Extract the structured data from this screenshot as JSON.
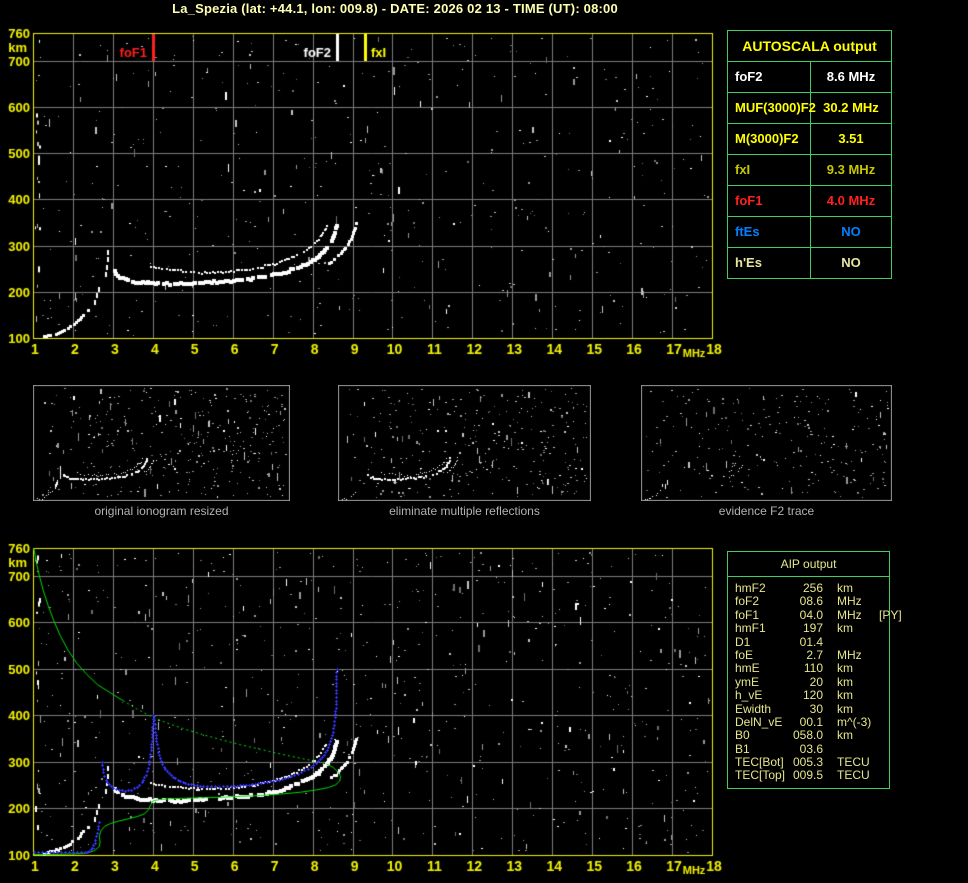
{
  "window": {
    "title": "La_Spezia (lat: +44.1, lon: 009.8) - DATE: 2026 02 13 - TIME (UT): 08:00"
  },
  "autoscala_table": {
    "header": "AUTOSCALA output",
    "rows": [
      {
        "label": "foF2",
        "value": "8.6 MHz",
        "color": "#ffffff"
      },
      {
        "label": "MUF(3000)F2",
        "value": "30.2 MHz",
        "color": "#ffff00"
      },
      {
        "label": "M(3000)F2",
        "value": "3.51",
        "color": "#ffff00"
      },
      {
        "label": "fxI",
        "value": "9.3 MHz",
        "color": "#c8c800"
      },
      {
        "label": "foF1",
        "value": "4.0 MHz",
        "color": "#ff2020"
      },
      {
        "label": "ftEs",
        "value": "NO",
        "color": "#0080ff"
      },
      {
        "label": "h'Es",
        "value": "NO",
        "color": "#e8e8a0"
      }
    ]
  },
  "aip_table": {
    "header": "AIP output",
    "rows": [
      {
        "name": "hmF2",
        "value": "256",
        "unit": "km",
        "extra": ""
      },
      {
        "name": "foF2",
        "value": "08.6",
        "unit": "MHz",
        "extra": ""
      },
      {
        "name": "foF1",
        "value": "04.0",
        "unit": "MHz",
        "extra": "[PY]"
      },
      {
        "name": "hmF1",
        "value": "197",
        "unit": "km",
        "extra": ""
      },
      {
        "name": "D1",
        "value": "01.4",
        "unit": "",
        "extra": ""
      },
      {
        "name": "foE",
        "value": "2.7",
        "unit": "MHz",
        "extra": ""
      },
      {
        "name": "hmE",
        "value": "110",
        "unit": "km",
        "extra": ""
      },
      {
        "name": "ymE",
        "value": "20",
        "unit": "km",
        "extra": ""
      },
      {
        "name": "h_vE",
        "value": "120",
        "unit": "km",
        "extra": ""
      },
      {
        "name": "Ewidth",
        "value": "30",
        "unit": "km",
        "extra": ""
      },
      {
        "name": "DelN_vE",
        "value": "00.1",
        "unit": "m^(-3)",
        "extra": ""
      },
      {
        "name": "B0",
        "value": "058.0",
        "unit": "km",
        "extra": ""
      },
      {
        "name": "B1",
        "value": "03.6",
        "unit": "",
        "extra": ""
      },
      {
        "name": "TEC[Bot]",
        "value": "005.3",
        "unit": "TECU",
        "extra": ""
      },
      {
        "name": "TEC[Top]",
        "value": "009.5",
        "unit": "TECU",
        "extra": ""
      }
    ]
  },
  "panels": [
    {
      "caption": "original ionogram resized"
    },
    {
      "caption": "eliminate multiple reflections"
    },
    {
      "caption": "evidence F2 trace"
    }
  ],
  "chart_data": {
    "type": "scatter",
    "title": "Ionogram La_Spezia 2026-02-13 08:00 UT",
    "axes": {
      "xlabel": "MHz",
      "ylabel": "km",
      "xlim": [
        1,
        18
      ],
      "ylim": [
        100,
        760
      ],
      "x_ticks": [
        1,
        2,
        3,
        4,
        5,
        6,
        7,
        8,
        9,
        10,
        11,
        12,
        13,
        14,
        15,
        16,
        17,
        18
      ],
      "y_ticks": [
        760,
        700,
        600,
        500,
        400,
        300,
        200,
        100
      ],
      "grid": true
    },
    "colors": {
      "axis": "#f2f200",
      "tick_label": "#f2f200",
      "grid": "#7c7c7c",
      "echo_white": "#ffffff",
      "profile_green": "#00dc00",
      "synthesized_blue": "#3434ff",
      "table_border": "#3ecf60"
    },
    "markers": [
      {
        "label": "foF1",
        "freq_mhz": 4.0,
        "color": "#ff2020",
        "side": "left"
      },
      {
        "label": "foF2",
        "freq_mhz": 8.6,
        "color": "#ffffff",
        "side": "left"
      },
      {
        "label": "fxI",
        "freq_mhz": 9.3,
        "color": "#ffff00",
        "side": "right"
      }
    ],
    "traces": {
      "w_e": {
        "desc": "E-region echo tail",
        "color": "#ffffff",
        "width": 3,
        "style": "chunk",
        "points": [
          [
            1.3,
            102
          ],
          [
            1.45,
            105
          ],
          [
            1.6,
            109
          ],
          [
            1.75,
            114
          ],
          [
            1.9,
            121
          ],
          [
            2.05,
            130
          ],
          [
            2.18,
            141
          ],
          [
            2.3,
            153
          ],
          [
            2.42,
            166
          ]
        ]
      },
      "w_e2": {
        "desc": "sparse echoes above E",
        "color": "#ffffff",
        "width": 2,
        "style": "blocks",
        "points": [
          [
            2.55,
            178
          ],
          [
            2.6,
            192
          ],
          [
            2.65,
            206
          ],
          [
            2.83,
            238
          ],
          [
            2.85,
            254
          ],
          [
            2.87,
            270
          ],
          [
            2.89,
            286
          ]
        ]
      },
      "w_f": {
        "desc": "F-region main echo trace",
        "color": "#ffffff",
        "width": 4,
        "style": "chunk",
        "points": [
          [
            3.05,
            243
          ],
          [
            3.12,
            234
          ],
          [
            3.25,
            228
          ],
          [
            3.45,
            223
          ],
          [
            3.7,
            220
          ],
          [
            4.0,
            218
          ],
          [
            4.35,
            217
          ],
          [
            4.7,
            217
          ],
          [
            5.05,
            218
          ],
          [
            5.4,
            220
          ],
          [
            5.75,
            222
          ],
          [
            6.1,
            224
          ],
          [
            6.45,
            228
          ],
          [
            6.8,
            232
          ],
          [
            7.1,
            237
          ],
          [
            7.4,
            245
          ],
          [
            7.7,
            254
          ],
          [
            7.95,
            265
          ],
          [
            8.15,
            277
          ],
          [
            8.32,
            291
          ],
          [
            8.45,
            307
          ],
          [
            8.55,
            326
          ],
          [
            8.62,
            347
          ]
        ]
      },
      "w_fu": {
        "desc": "F-region upper echo branch",
        "color": "#ffffff",
        "width": 2,
        "style": "chunk",
        "points": [
          [
            3.95,
            253
          ],
          [
            4.3,
            249
          ],
          [
            4.7,
            245
          ],
          [
            5.1,
            242
          ],
          [
            5.5,
            241
          ],
          [
            5.9,
            243
          ],
          [
            6.3,
            247
          ],
          [
            6.7,
            253
          ],
          [
            7.0,
            259
          ],
          [
            7.3,
            267
          ],
          [
            7.6,
            278
          ],
          [
            7.85,
            291
          ],
          [
            8.05,
            305
          ],
          [
            8.2,
            319
          ],
          [
            8.3,
            333
          ],
          [
            8.38,
            347
          ]
        ]
      },
      "w_x": {
        "desc": "x-mode rising tip near fxI",
        "color": "#ffffff",
        "width": 3,
        "style": "chunk",
        "points": [
          [
            8.42,
            262
          ],
          [
            8.6,
            273
          ],
          [
            8.76,
            287
          ],
          [
            8.9,
            303
          ],
          [
            9.0,
            320
          ],
          [
            9.07,
            339
          ],
          [
            9.1,
            354
          ]
        ]
      },
      "g_top": {
        "desc": "AIP profile topside (solid)",
        "color": "#00dc00",
        "width": 1,
        "style": "line",
        "points": [
          [
            1.02,
            760
          ],
          [
            1.08,
            730
          ],
          [
            1.16,
            700
          ],
          [
            1.26,
            668
          ],
          [
            1.38,
            636
          ],
          [
            1.52,
            604
          ],
          [
            1.68,
            572
          ],
          [
            1.88,
            540
          ],
          [
            2.1,
            512
          ],
          [
            2.35,
            488
          ],
          [
            2.62,
            466
          ],
          [
            2.95,
            448
          ],
          [
            3.25,
            432
          ]
        ]
      },
      "g_mid": {
        "desc": "AIP profile (dotted)",
        "color": "#00dc00",
        "width": 1,
        "style": "dash",
        "points": [
          [
            3.25,
            432
          ],
          [
            3.6,
            414
          ],
          [
            3.95,
            398
          ],
          [
            4.35,
            384
          ],
          [
            4.75,
            372
          ],
          [
            5.2,
            360
          ],
          [
            5.7,
            348
          ],
          [
            6.2,
            337
          ],
          [
            6.7,
            327
          ],
          [
            7.2,
            317
          ],
          [
            7.7,
            308
          ],
          [
            8.1,
            301
          ],
          [
            8.35,
            296
          ]
        ]
      },
      "g_bot": {
        "desc": "AIP profile F-peak wrap and bottomside",
        "color": "#00dc00",
        "width": 1,
        "style": "line",
        "points": [
          [
            8.35,
            296
          ],
          [
            8.52,
            288
          ],
          [
            8.63,
            279
          ],
          [
            8.7,
            269
          ],
          [
            8.68,
            259
          ],
          [
            8.58,
            251
          ],
          [
            8.4,
            245
          ],
          [
            8.1,
            240
          ],
          [
            7.7,
            235
          ],
          [
            7.2,
            231
          ],
          [
            6.7,
            228
          ],
          [
            6.2,
            226
          ],
          [
            5.7,
            224
          ],
          [
            5.2,
            223
          ],
          [
            4.8,
            222
          ],
          [
            4.45,
            221
          ],
          [
            4.15,
            219
          ],
          [
            4.0,
            216
          ],
          [
            3.95,
            208
          ],
          [
            3.88,
            196
          ],
          [
            3.78,
            188
          ],
          [
            3.62,
            183
          ],
          [
            3.4,
            178
          ],
          [
            3.15,
            173
          ],
          [
            2.95,
            168
          ],
          [
            2.8,
            162
          ],
          [
            2.7,
            152
          ],
          [
            2.66,
            140
          ],
          [
            2.68,
            128
          ],
          [
            2.66,
            118
          ],
          [
            2.55,
            110
          ],
          [
            2.4,
            105
          ],
          [
            2.2,
            103
          ],
          [
            1.9,
            102
          ],
          [
            1.5,
            101
          ],
          [
            1.02,
            101
          ]
        ]
      },
      "b_row": {
        "desc": "synthesized trace E (blue crosses)",
        "color": "#3434ff",
        "width": 1,
        "style": "plus",
        "points": [
          [
            1.02,
            106
          ],
          [
            2.3,
            106
          ],
          [
            2.4,
            109
          ],
          [
            2.48,
            116
          ],
          [
            2.54,
            126
          ],
          [
            2.58,
            140
          ],
          [
            2.62,
            156
          ],
          [
            2.64,
            170
          ]
        ]
      },
      "b_f1": {
        "desc": "synthesized F1 cusp at foF1",
        "color": "#3434ff",
        "width": 1,
        "style": "plus",
        "points": [
          [
            2.72,
            300
          ],
          [
            2.76,
            278
          ],
          [
            2.82,
            262
          ],
          [
            2.9,
            252
          ],
          [
            3.0,
            245
          ],
          [
            3.15,
            240
          ],
          [
            3.3,
            238
          ],
          [
            3.45,
            240
          ],
          [
            3.6,
            246
          ],
          [
            3.72,
            256
          ],
          [
            3.82,
            272
          ],
          [
            3.9,
            295
          ],
          [
            3.95,
            325
          ],
          [
            3.98,
            360
          ],
          [
            4.0,
            400
          ]
        ]
      },
      "b_f2": {
        "desc": "synthesized F2 branch to foF2 asymptote",
        "color": "#3434ff",
        "width": 1,
        "style": "plus",
        "points": [
          [
            4.03,
            398
          ],
          [
            4.06,
            365
          ],
          [
            4.1,
            338
          ],
          [
            4.16,
            314
          ],
          [
            4.24,
            295
          ],
          [
            4.35,
            280
          ],
          [
            4.5,
            268
          ],
          [
            4.68,
            259
          ],
          [
            4.88,
            253
          ],
          [
            5.1,
            250
          ],
          [
            5.35,
            248
          ],
          [
            5.65,
            247
          ],
          [
            5.95,
            248
          ],
          [
            6.25,
            250
          ],
          [
            6.55,
            253
          ],
          [
            6.85,
            257
          ],
          [
            7.15,
            262
          ],
          [
            7.45,
            269
          ],
          [
            7.72,
            278
          ],
          [
            7.95,
            289
          ],
          [
            8.14,
            302
          ],
          [
            8.28,
            316
          ],
          [
            8.39,
            332
          ],
          [
            8.47,
            351
          ],
          [
            8.52,
            372
          ],
          [
            8.56,
            396
          ],
          [
            8.58,
            424
          ],
          [
            8.59,
            455
          ],
          [
            8.6,
            500
          ]
        ]
      },
      "ev_e": {
        "desc": "evidence panel E remnants",
        "color": "#ffffff",
        "width": 1,
        "style": "chunk",
        "points": [
          [
            1.3,
            103
          ],
          [
            1.55,
            108
          ],
          [
            1.8,
            116
          ],
          [
            2.05,
            128
          ],
          [
            2.25,
            143
          ],
          [
            2.4,
            160
          ]
        ]
      },
      "ev_blob": {
        "desc": "evidence panel small blob",
        "color": "#ffffff",
        "width": 1,
        "style": "blocks",
        "points": [
          [
            2.7,
            182
          ],
          [
            2.85,
            202
          ]
        ]
      },
      "ev1": {
        "desc": "evidence F2 arc 1",
        "color": "#ffffff",
        "width": 1,
        "style": "chunk",
        "points": [
          [
            6.6,
            238
          ],
          [
            6.9,
            253
          ],
          [
            7.15,
            272
          ],
          [
            7.35,
            297
          ],
          [
            7.5,
            322
          ]
        ]
      },
      "ev2": {
        "desc": "evidence F2 arc 2",
        "color": "#ffffff",
        "width": 1,
        "style": "chunk",
        "points": [
          [
            7.0,
            232
          ],
          [
            7.3,
            247
          ],
          [
            7.6,
            266
          ],
          [
            7.85,
            291
          ],
          [
            8.0,
            318
          ]
        ]
      }
    },
    "plots": [
      {
        "name": "measured ionogram with AUTOSCALA markers",
        "traces": [
          "w_e",
          "w_e2",
          "w_f",
          "w_fu",
          "w_x"
        ],
        "show_markers": true,
        "noise_seed": 11,
        "noise_dots": 430,
        "noise_dashes": 70
      },
      {
        "name": "ionogram with AIP profile and synthesized trace",
        "traces": [
          "w_e",
          "w_e2",
          "w_f",
          "w_fu",
          "w_x",
          "g_top",
          "g_mid",
          "g_bot",
          "b_row",
          "b_f1",
          "b_f2"
        ],
        "show_markers": false,
        "noise_seed": 23,
        "noise_dots": 620,
        "noise_dashes": 120
      },
      {
        "name": "original ionogram resized",
        "traces": [
          "w_e",
          "w_e2",
          "w_f",
          "w_fu",
          "w_x"
        ],
        "show_markers": false,
        "noise_seed": 5,
        "noise_dots": 330,
        "noise_dashes": 40
      },
      {
        "name": "eliminate multiple reflections",
        "traces": [
          "w_e",
          "w_f",
          "w_fu",
          "w_x"
        ],
        "show_markers": false,
        "noise_seed": 9,
        "noise_dots": 300,
        "noise_dashes": 30
      },
      {
        "name": "evidence F2 trace",
        "traces": [
          "ev_e",
          "ev_blob",
          "ev1",
          "ev2"
        ],
        "show_markers": false,
        "noise_seed": 13,
        "noise_dots": 240,
        "noise_dashes": 20
      }
    ]
  }
}
